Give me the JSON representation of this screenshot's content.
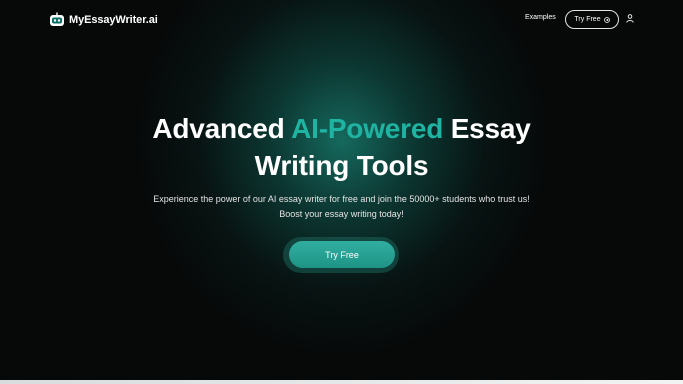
{
  "nav": {
    "logo_text": "MyEssayWriter.ai",
    "examples_label": "Examples",
    "try_free_label": "Try Free",
    "try_free_icon": "arrow-right-circle-icon",
    "user_icon": "user-icon"
  },
  "hero": {
    "title_part1": "Advanced ",
    "title_accent": "AI-Powered",
    "title_part2": " Essay",
    "title_line2": "Writing Tools",
    "subtitle_line1": "Experience the power of our AI essay writer for free and join the 50000+ students who trust us!",
    "subtitle_line2": "Boost your essay writing today!",
    "cta_label": "Try Free"
  },
  "colors": {
    "accent": "#1fb3a1",
    "button": "#23998b",
    "background": "#070909"
  }
}
